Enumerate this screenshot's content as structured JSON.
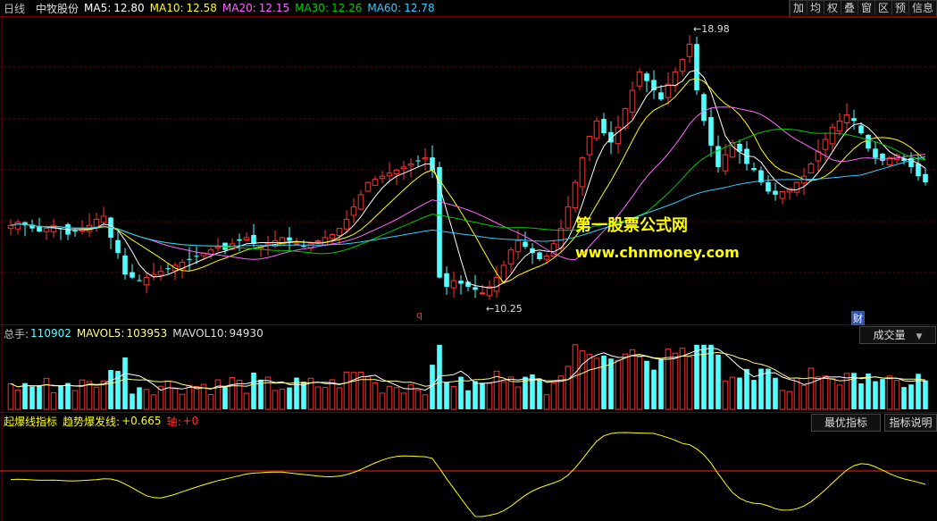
{
  "header": {
    "period": "日线",
    "stock_name": "中牧股份",
    "ma": [
      {
        "label": "MA5:",
        "value": "12.80",
        "color": "#ffffff"
      },
      {
        "label": "MA10:",
        "value": "12.58",
        "color": "#ffff00"
      },
      {
        "label": "MA20:",
        "value": "12.15",
        "color": "#ff66ff"
      },
      {
        "label": "MA30:",
        "value": "12.26",
        "color": "#00cc00"
      },
      {
        "label": "MA60:",
        "value": "12.78",
        "color": "#33ccff"
      }
    ],
    "toolbar": [
      "加",
      "均",
      "权",
      "叠",
      "窗",
      "区",
      "预",
      "信息"
    ]
  },
  "price_pane": {
    "high_label": "18.98",
    "low_label": "10.25",
    "q_marker": "q",
    "cai_marker": "财",
    "watermark_line1": "第一股票公式网",
    "watermark_line2": "www.chnmoney.com"
  },
  "volume_pane": {
    "label": "总手:",
    "value": "110902",
    "mavol5_label": "MAVOL5:",
    "mavol5_value": "103953",
    "mavol10_label": "MAVOL10:",
    "mavol10_value": "94930",
    "selector": "成交量"
  },
  "indicator_pane": {
    "name": "起爆线指标",
    "line_label": "趋势爆发线:",
    "line_value": "+0.665",
    "axis_label": "轴:",
    "axis_value": "+0",
    "buttons": [
      "最优指标",
      "指标说明"
    ]
  },
  "colors": {
    "up": "#ff3232",
    "down": "#54ffff",
    "grid": "#7a0000"
  },
  "chart_data": {
    "type": "candlestick",
    "price_range": [
      10.25,
      18.98
    ],
    "closes": [
      12.6,
      12.7,
      12.6,
      12.5,
      12.4,
      12.5,
      12.6,
      12.5,
      12.3,
      12.4,
      12.5,
      12.6,
      12.8,
      12.9,
      12.2,
      11.7,
      11.0,
      10.9,
      10.8,
      10.9,
      11.0,
      11.1,
      11.2,
      11.3,
      11.4,
      11.5,
      11.6,
      11.7,
      11.8,
      11.9,
      11.8,
      12.0,
      12.1,
      12.2,
      12.0,
      11.9,
      12.0,
      12.1,
      12.2,
      12.1,
      12.0,
      11.9,
      12.0,
      12.1,
      12.2,
      12.3,
      12.5,
      12.8,
      13.2,
      13.6,
      14.0,
      14.1,
      14.2,
      14.3,
      14.4,
      14.5,
      14.6,
      14.7,
      14.8,
      14.4,
      10.9,
      10.6,
      10.8,
      10.7,
      10.6,
      10.5,
      10.4,
      10.6,
      10.9,
      11.3,
      11.8,
      12.1,
      11.9,
      11.7,
      11.5,
      11.6,
      12.0,
      12.5,
      13.2,
      14.0,
      14.8,
      15.5,
      16.0,
      15.6,
      15.3,
      15.8,
      16.4,
      17.0,
      17.6,
      17.3,
      17.0,
      16.7,
      17.2,
      17.6,
      18.0,
      18.5,
      17.0,
      16.0,
      15.2,
      14.5,
      14.9,
      15.3,
      15.0,
      14.6,
      14.4,
      14.0,
      13.7,
      13.6,
      13.7,
      13.8,
      14.0,
      14.2,
      14.6,
      15.0,
      15.4,
      15.8,
      16.0,
      16.2,
      16.0,
      15.6,
      15.1,
      14.8,
      14.7,
      14.8,
      14.9,
      14.7,
      14.5,
      14.2,
      14.0
    ],
    "volume_range": [
      0,
      160000
    ],
    "mavol5": 103953,
    "mavol10": 94930,
    "volume": 110902,
    "indicator_value": 0.665,
    "indicator_axis": 0
  }
}
